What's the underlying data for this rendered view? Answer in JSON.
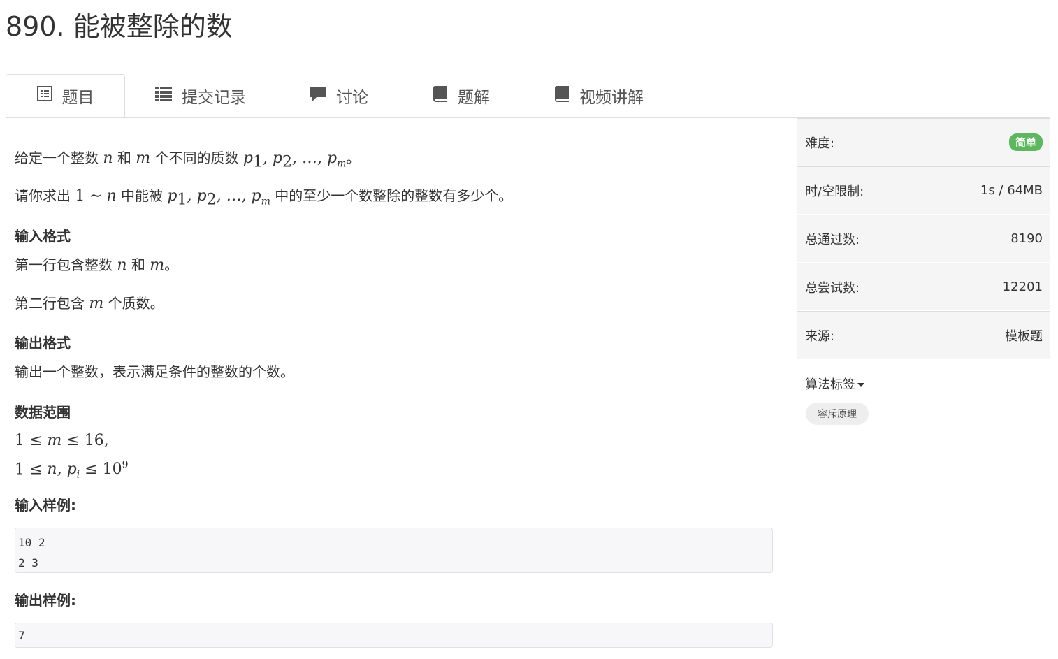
{
  "problem": {
    "title": "890. 能被整除的数"
  },
  "tabs": [
    {
      "label": "题目",
      "icon": "list-alt-icon"
    },
    {
      "label": "提交记录",
      "icon": "list-icon"
    },
    {
      "label": "讨论",
      "icon": "comment-icon"
    },
    {
      "label": "题解",
      "icon": "book-icon"
    },
    {
      "label": "视频讲解",
      "icon": "book-icon"
    }
  ],
  "statement": {
    "p1_pre": "给定一个整数",
    "p1_mid1": "和",
    "p1_mid2": "个不同的质数",
    "p1_end": "。",
    "p2_pre": "请你求出",
    "p2_mid": "中能被",
    "p2_end": "中的至少一个数整除的整数有多少个。",
    "input_heading": "输入格式",
    "input_line1_pre": "第一行包含整数",
    "input_line1_mid": "和",
    "input_line1_end": "。",
    "input_line2_pre": "第二行包含",
    "input_line2_end": "个质数。",
    "output_heading": "输出格式",
    "output_line": "输出一个整数，表示满足条件的整数的个数。",
    "range_heading": "数据范围",
    "sample_input_heading": "输入样例:",
    "sample_input": "10 2\n2 3",
    "sample_output_heading": "输出样例:",
    "sample_output": "7"
  },
  "sidebar": {
    "difficulty_label": "难度:",
    "difficulty_value": "简单",
    "limit_label": "时/空限制:",
    "limit_value": "1s / 64MB",
    "passed_label": "总通过数:",
    "passed_value": "8190",
    "attempts_label": "总尝试数:",
    "attempts_value": "12201",
    "source_label": "来源:",
    "source_value": "模板题",
    "tags_label": "算法标签",
    "tags": [
      "容斥原理"
    ]
  },
  "colors": {
    "difficulty_easy": "#5cb85c",
    "text": "#333333"
  }
}
